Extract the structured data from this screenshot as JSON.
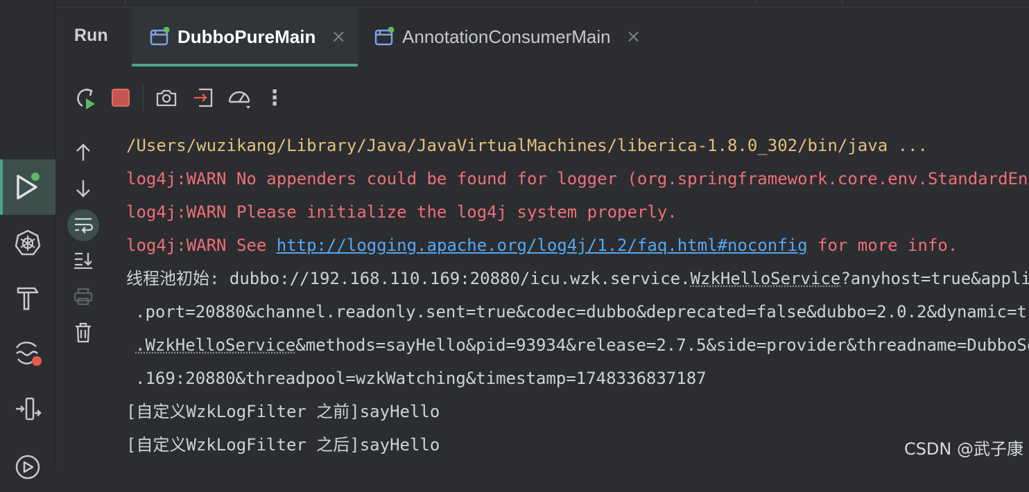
{
  "window": {
    "title": "Run"
  },
  "tabs": [
    {
      "label": "DubboPureMain",
      "close": "×",
      "selected": true
    },
    {
      "label": "AnnotationConsumerMain",
      "close": "×",
      "selected": false
    }
  ],
  "left_strip": {
    "items": [
      {
        "name": "run-icon",
        "active": true
      },
      {
        "name": "kubernetes-icon"
      },
      {
        "name": "build-hammer-icon"
      },
      {
        "name": "problems-icon"
      },
      {
        "name": "structure-icon"
      },
      {
        "name": "services-icon"
      }
    ]
  },
  "toolbar": {
    "items": [
      "rerun-icon",
      "stop-icon",
      "screenshot-icon",
      "attach-debugger-icon",
      "profiler-icon",
      "more-icon"
    ],
    "more": "⋮"
  },
  "side_toolbar": {
    "items": [
      "up-arrow-icon",
      "down-arrow-icon",
      "soft-wrap-icon",
      "scroll-to-end-icon",
      "print-icon",
      "clear-icon"
    ]
  },
  "console": {
    "lines": [
      {
        "text": "/Users/wuzikang/Library/Java/JavaVirtualMachines/liberica-1.8.0_302/bin/java ..."
      },
      {
        "text": "log4j:WARN No appenders could be found for logger (org.springframework.core.env.StandardEnv"
      },
      {
        "text": "log4j:WARN Please initialize the log4j system properly."
      },
      {
        "pre": "log4j:WARN See ",
        "link": "http://logging.apache.org/log4j/1.2/faq.html#noconfig",
        "post": " for more info."
      },
      {
        "pre": "线程池初始: dubbo://192.168.110.169:20880/icu.wzk.service.",
        "mark": "WzkHelloService",
        "post": "?anyhost=true&appli"
      },
      {
        "text": ".port=20880&channel.readonly.sent=true&codec=dubbo&deprecated=false&dubbo=2.0.2&dynamic=tr"
      },
      {
        "mark": ".WzkHelloService",
        "post": "&methods=sayHello&pid=93934&release=2.7.5&side=provider&threadname=DubboSe"
      },
      {
        "text": ".169:20880&threadpool=wzkWatching&timestamp=1748336837187"
      },
      {
        "text": "[自定义WzkLogFilter 之前]sayHello"
      },
      {
        "text": "[自定义WzkLogFilter 之后]sayHello"
      }
    ]
  },
  "watermark": "CSDN @武子康",
  "colors": {
    "accent": "#4fa38c",
    "path_text": "#e5c07b",
    "warn_text": "#ef6f79",
    "plain_text": "#cfd2d6",
    "link": "#56a8f5",
    "stop_button": "#c75450",
    "status_dot": "#5fb865",
    "error_dot": "#e55b4d"
  }
}
